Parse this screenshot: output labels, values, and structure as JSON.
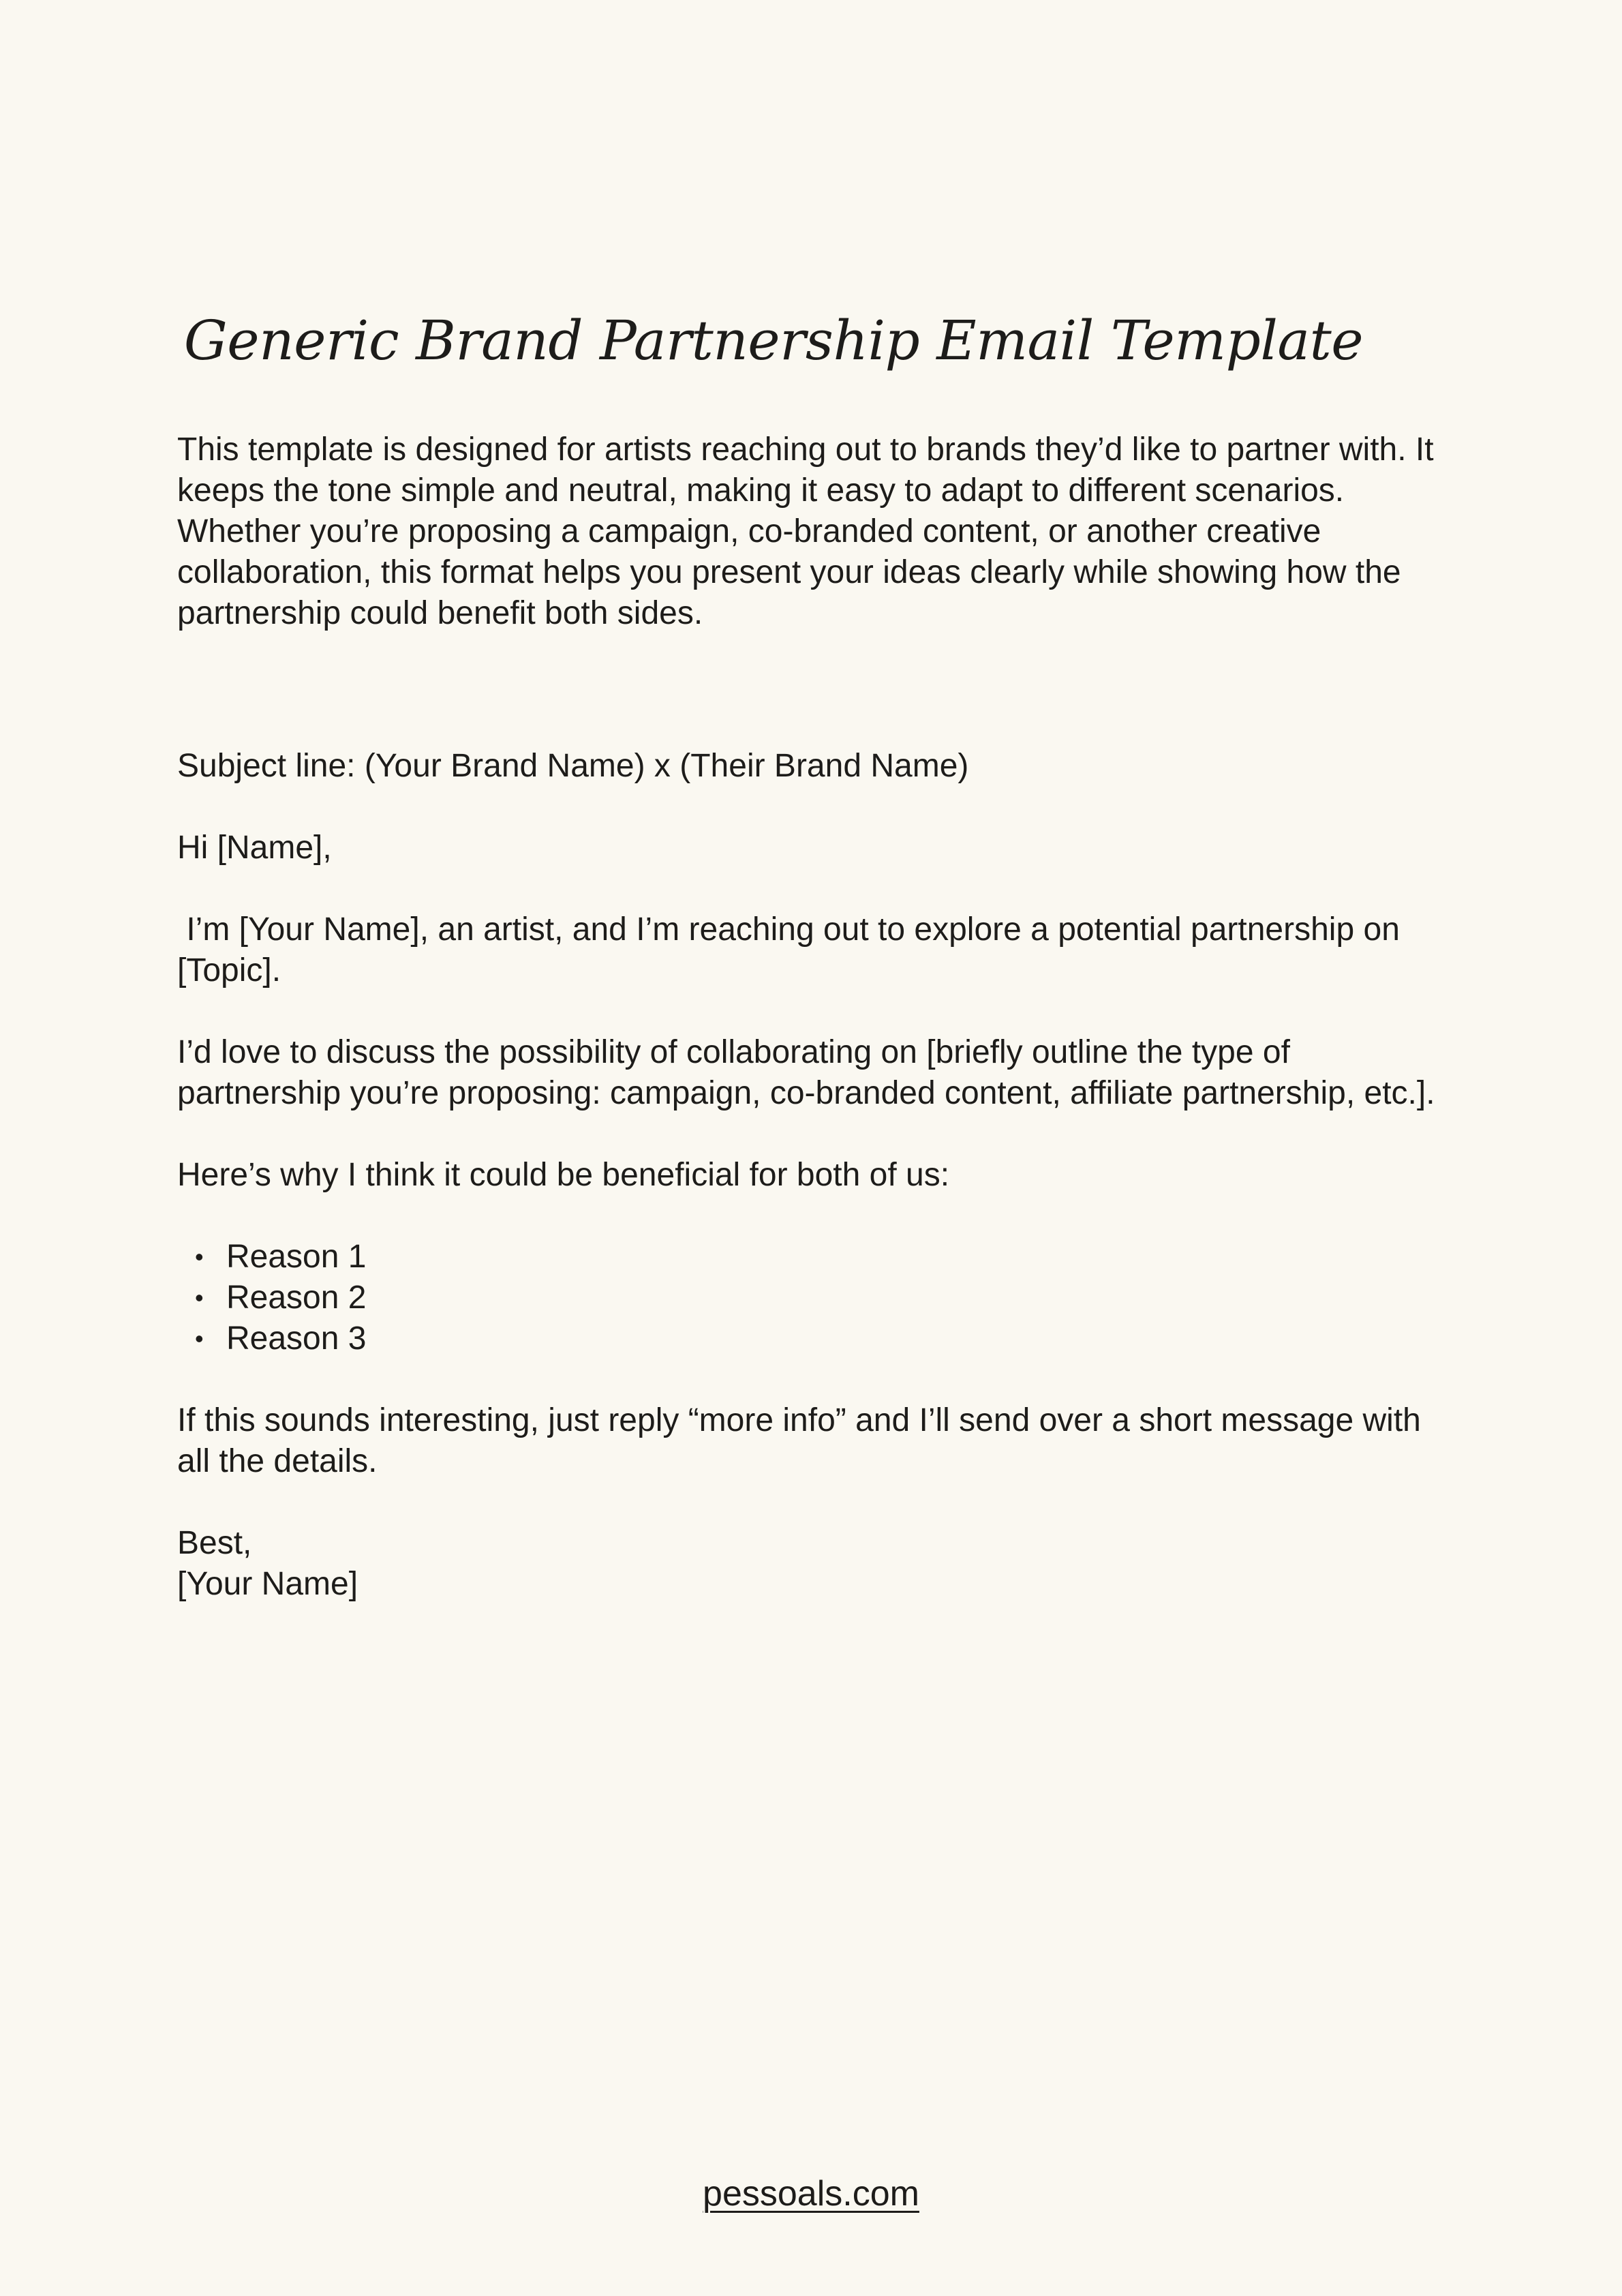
{
  "document": {
    "title": "Generic Brand Partnership Email Template",
    "intro": "This template is designed for artists reaching out to brands they’d like to partner with. It keeps the tone simple and neutral, making it easy to adapt to different scenarios. Whether you’re proposing a campaign, co-branded content, or another creative collaboration, this format helps you present your ideas clearly while showing how the partnership could benefit both sides."
  },
  "email": {
    "subject_line": "Subject line: (Your Brand Name) x (Their Brand Name)",
    "greeting": "Hi [Name],",
    "paragraph_1": " I’m [Your Name], an artist, and I’m reaching out to explore a potential partnership on [Topic].",
    "paragraph_2": "I’d love to discuss the possibility of collaborating on [briefly outline the type of partnership you’re proposing: campaign, co-branded content, affiliate partnership, etc.].",
    "reasons_intro": "Here’s why I think it could be beneficial for both of us:",
    "reasons": [
      "Reason 1",
      "Reason 2",
      "Reason 3"
    ],
    "bullet_symbol": "•",
    "paragraph_3": "If this sounds interesting, just reply “more info” and I’ll send over a short message with all the details.",
    "sign_off": "Best,",
    "signature": "[Your Name]"
  },
  "footer": {
    "link_text": "pessoals.com"
  },
  "colors": {
    "background": "#faf8f1",
    "text": "#1d1c1a"
  }
}
